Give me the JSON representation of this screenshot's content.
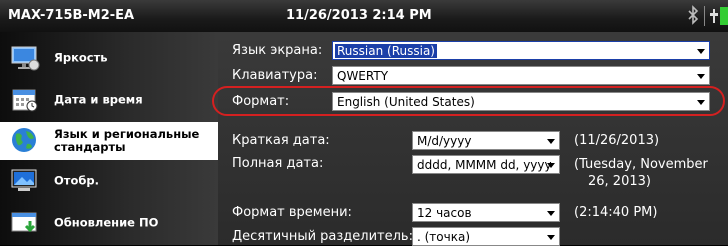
{
  "titlebar": {
    "device": "MAX-715B-M2-EA",
    "datetime": "11/26/2013 2:14 PM"
  },
  "sidebar": {
    "items": [
      {
        "label": "Яркость",
        "icon": "brightness-monitor-icon"
      },
      {
        "label": "Дата и время",
        "icon": "calendar-icon"
      },
      {
        "label": "Язык и региональные стандарты",
        "icon": "globe-icon"
      },
      {
        "label": "Отобр.",
        "icon": "display-icon"
      },
      {
        "label": "Обновление ПО",
        "icon": "software-update-icon"
      }
    ]
  },
  "settings": {
    "screen_language": {
      "label": "Язык экрана:",
      "value": "Russian (Russia)"
    },
    "keyboard": {
      "label": "Клавиатура:",
      "value": "QWERTY"
    },
    "format": {
      "label": "Формат:",
      "value": "English (United States)"
    },
    "short_date": {
      "label": "Краткая дата:",
      "value": "M/d/yyyy",
      "example": "(11/26/2013)"
    },
    "long_date": {
      "label": "Полная дата:",
      "value": "dddd, MMMM dd, yyyy",
      "example_line1": "(Tuesday, November",
      "example_line2": "26, 2013)"
    },
    "time_format": {
      "label": "Формат времени:",
      "value": "12 часов",
      "example": "(2:14:40 PM)"
    },
    "decimal_separator": {
      "label": "Десятичный разделитель:",
      "value": ". (точка)"
    }
  }
}
